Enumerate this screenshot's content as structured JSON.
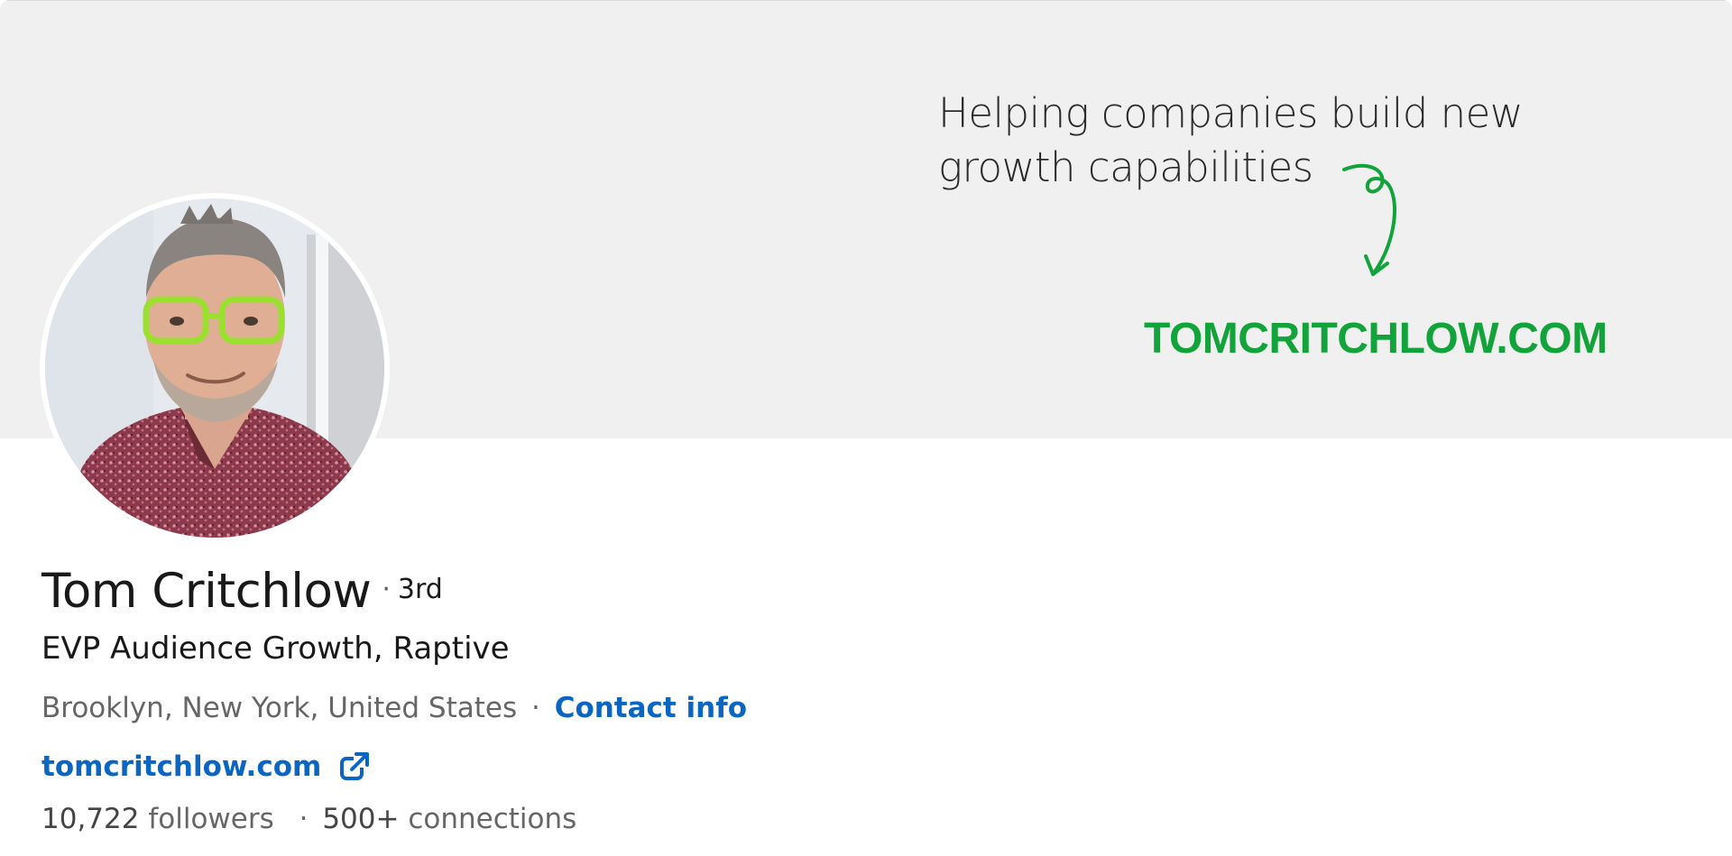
{
  "banner": {
    "tagline_line1": "Helping companies build new",
    "tagline_line2": "growth capabilities",
    "site": "TOMCRITCHLOW.COM",
    "arrow_icon": "curly-arrow-down-icon",
    "accent_color": "#12a33a"
  },
  "profile": {
    "name": "Tom Critchlow",
    "degree_separator": "·",
    "degree": "3rd",
    "headline": "EVP Audience Growth, Raptive",
    "location": "Brooklyn, New York, United States",
    "location_separator": "·",
    "contact_label": "Contact info",
    "website": "tomcritchlow.com",
    "website_icon": "external-link-icon",
    "followers_count": "10,722",
    "followers_label": "followers",
    "connections_separator": "·",
    "connections_count": "500+",
    "connections_label": "connections",
    "link_color": "#0a66c2"
  }
}
